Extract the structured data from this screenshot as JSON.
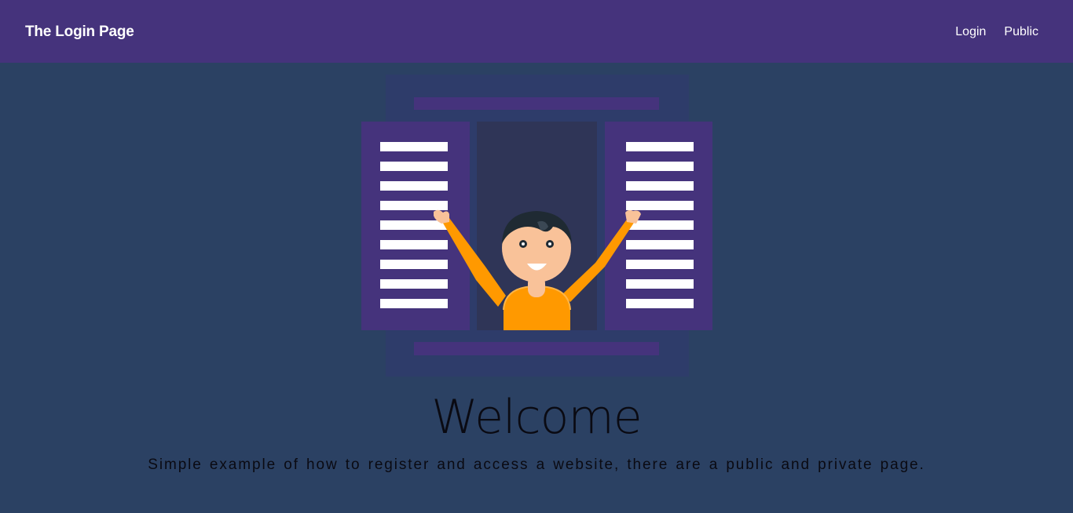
{
  "navbar": {
    "brand": "The Login Page",
    "links": [
      {
        "label": "Login"
      },
      {
        "label": "Public"
      }
    ]
  },
  "hero": {
    "title": "Welcome",
    "subtitle": "Simple example of how to register and access a website, there are a public and private page."
  },
  "colors": {
    "navbar_bg": "#45337c",
    "page_bg": "#2b4163",
    "window_frame": "#2e3c6a",
    "shutter": "#45337c",
    "window_interior": "#2f3557",
    "shirt": "#ff9900",
    "skin": "#f9c299",
    "hair": "#1f2a33",
    "text_dark": "#0a0a12"
  }
}
